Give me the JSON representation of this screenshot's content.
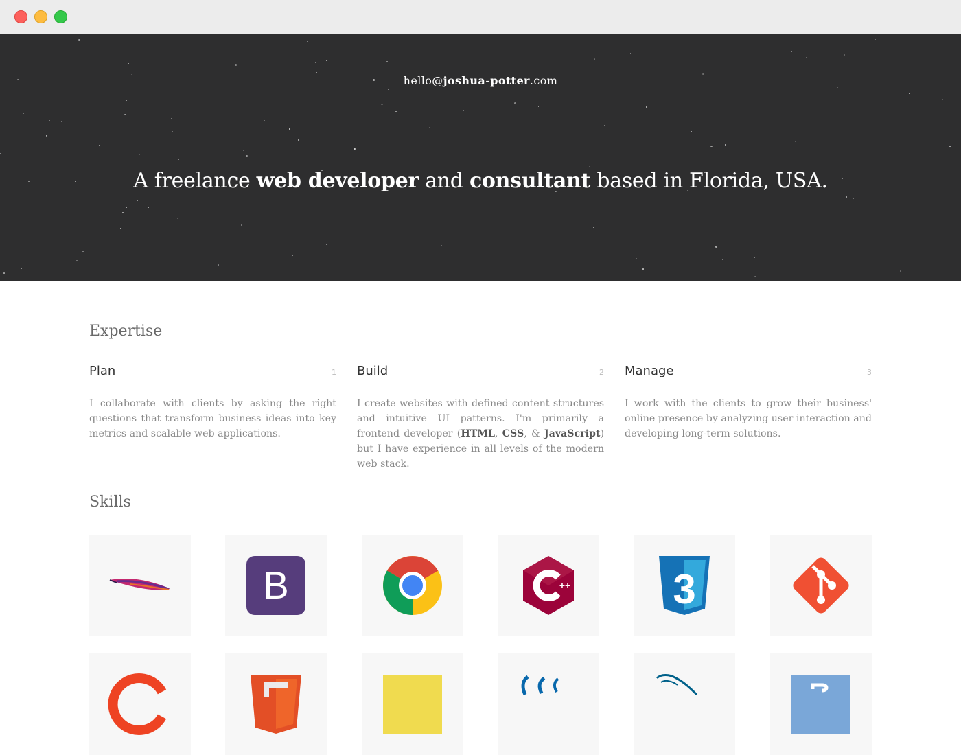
{
  "window": {
    "controls": [
      "close",
      "minimize",
      "zoom"
    ]
  },
  "hero": {
    "email_user": "hello@",
    "email_domain": "joshua-potter",
    "email_tld": ".com",
    "tagline_1": "A freelance ",
    "tagline_2": "web developer",
    "tagline_3": " and ",
    "tagline_4": "consultant",
    "tagline_5": " based in Florida, USA."
  },
  "expertise": {
    "title": "Expertise",
    "columns": [
      {
        "title": "Plan",
        "num": "1",
        "text": "I collaborate with clients by asking the right questions that transform business ideas into key metrics and scalable web applications."
      },
      {
        "title": "Build",
        "num": "2",
        "text_a": "I create websites with defined content structures and intuitive UI patterns. I'm primarily a frontend developer (",
        "html": "HTML",
        "sep1": ", ",
        "css": "CSS",
        "sep2": ", & ",
        "js": "JavaScript",
        "text_b": ") but I have experience in all levels of the modern web stack."
      },
      {
        "title": "Manage",
        "num": "3",
        "text": "I work with the clients to grow their business' online presence by analyzing user interaction and developing long-term solutions."
      }
    ]
  },
  "skills": {
    "title": "Skills",
    "icons": [
      "apache-feather-icon",
      "bootstrap-icon",
      "chrome-icon",
      "cplusplus-icon",
      "css3-icon",
      "git-icon",
      "codeigniter-icon",
      "html5-icon",
      "javascript-icon",
      "jquery-icon",
      "mysql-icon",
      "php-icon"
    ],
    "bootstrap_letter": "B",
    "cpp_plus": "++",
    "css_num": "3"
  },
  "colors": {
    "hero_bg": "#2e2e2f",
    "tile_bg": "#f7f7f7",
    "bootstrap": "#563d7c",
    "cpp": "#9c033a",
    "css3": "#1572b6",
    "git": "#f05033",
    "html5": "#e34f26",
    "js": "#f0db4f",
    "php": "#8892bf"
  }
}
